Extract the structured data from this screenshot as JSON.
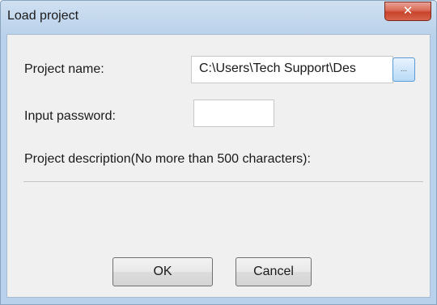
{
  "window": {
    "title": "Load project",
    "close_symbol": "✕"
  },
  "form": {
    "project_name_label": "Project name:",
    "project_name_value": "C:\\Users\\Tech Support\\Des",
    "browse_label": "...",
    "password_label": "Input password:",
    "password_value": "",
    "description_label": "Project description(No more than 500 characters):",
    "description_value": ""
  },
  "buttons": {
    "ok_label": "OK",
    "cancel_label": "Cancel"
  },
  "colors": {
    "frame": "#b9d1ea",
    "close_button": "#c7432b",
    "client_background": "#f0f0f0"
  }
}
